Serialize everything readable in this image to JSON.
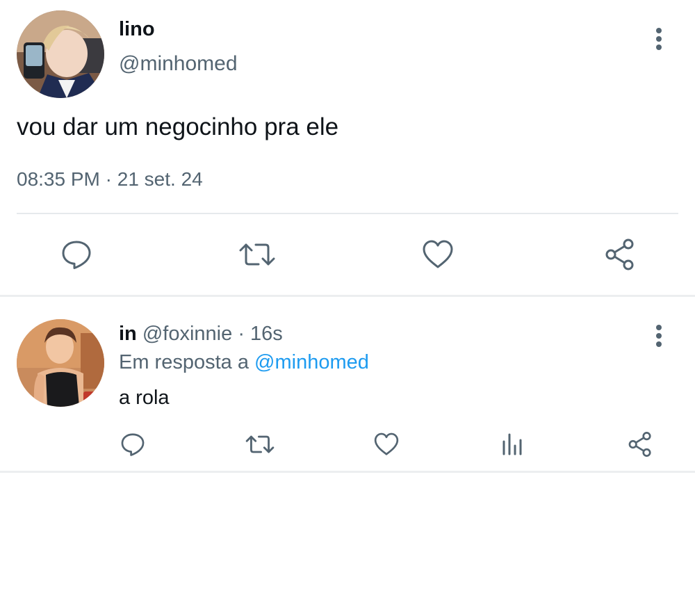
{
  "main_tweet": {
    "author_name": "lino",
    "author_handle": "@minhomed",
    "text": "vou dar um negocinho pra ele",
    "time": "08:35 PM",
    "separator": "·",
    "date": "21 set. 24"
  },
  "reply_tweet": {
    "author_name": "in",
    "author_handle": "@foxinnie",
    "separator": "·",
    "age": "16s",
    "reply_prefix": "Em resposta a",
    "reply_mention": "@minhomed",
    "text": "a rola"
  },
  "icons": {
    "reply": "speech-bubble-icon",
    "retweet": "retweet-arrows-icon",
    "like": "heart-icon",
    "views": "bar-chart-icon",
    "share": "share-nodes-icon",
    "more": "vertical-ellipsis-icon"
  },
  "colors": {
    "text_primary": "#0f1419",
    "text_secondary": "#536471",
    "link": "#1d9bf0",
    "icon": "#536471",
    "divider": "#e6e9ec"
  }
}
